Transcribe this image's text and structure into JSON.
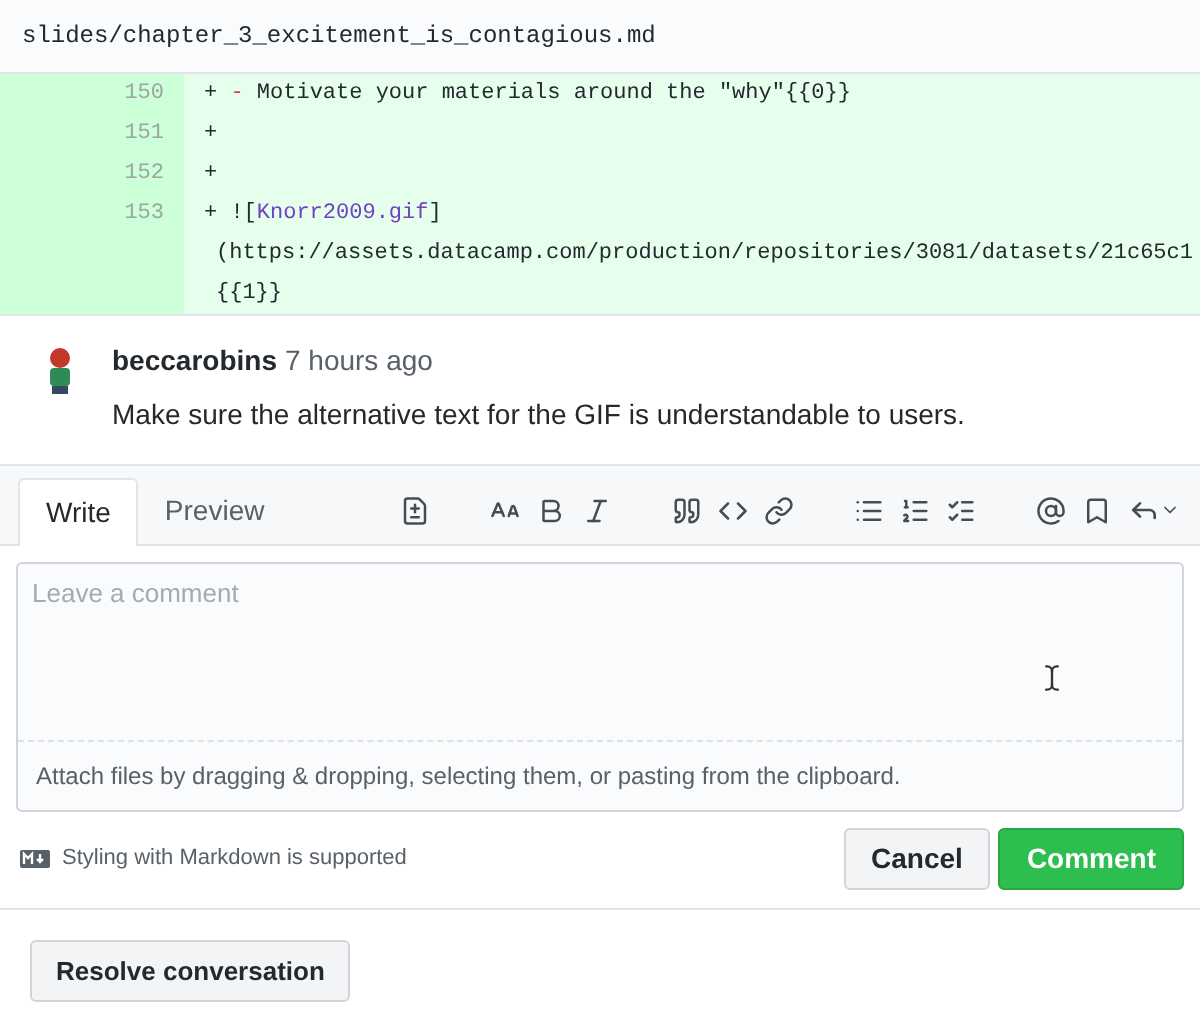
{
  "file_header": {
    "path": "slides/chapter_3_excitement_is_contagious.md"
  },
  "diff_lines": [
    {
      "number": "150",
      "prefix": "+",
      "parts": [
        {
          "kind": "marker",
          "text": "-"
        },
        {
          "kind": "plain",
          "text": " Motivate your materials around the \"why\"{{0}}"
        }
      ]
    },
    {
      "number": "151",
      "prefix": "+"
    },
    {
      "number": "152",
      "prefix": "+"
    },
    {
      "number": "153",
      "prefix": "+",
      "parts": [
        {
          "kind": "plain",
          "text": "!["
        },
        {
          "kind": "link",
          "text": "Knorr2009.gif"
        },
        {
          "kind": "plain",
          "text": "]"
        }
      ],
      "continuation": [
        "(https://assets.datacamp.com/production/repositories/3081/datasets/21c65c1",
        "{{1}}"
      ]
    }
  ],
  "comment": {
    "author": "beccarobins",
    "time": "7 hours ago",
    "body": "Make sure the alternative text for the GIF is understandable to users."
  },
  "tabs": [
    {
      "label": "Write",
      "selected": true
    },
    {
      "label": "Preview",
      "selected": false
    }
  ],
  "editor": {
    "placeholder": "Leave a comment",
    "attach_hint": "Attach files by dragging & dropping, selecting them, or pasting from the clipboard."
  },
  "markdown_note": "Styling with Markdown is supported",
  "buttons": [
    {
      "label": "Cancel",
      "kind": "secondary"
    },
    {
      "label": "Comment",
      "kind": "primary"
    }
  ],
  "resolve_button": "Resolve conversation"
}
